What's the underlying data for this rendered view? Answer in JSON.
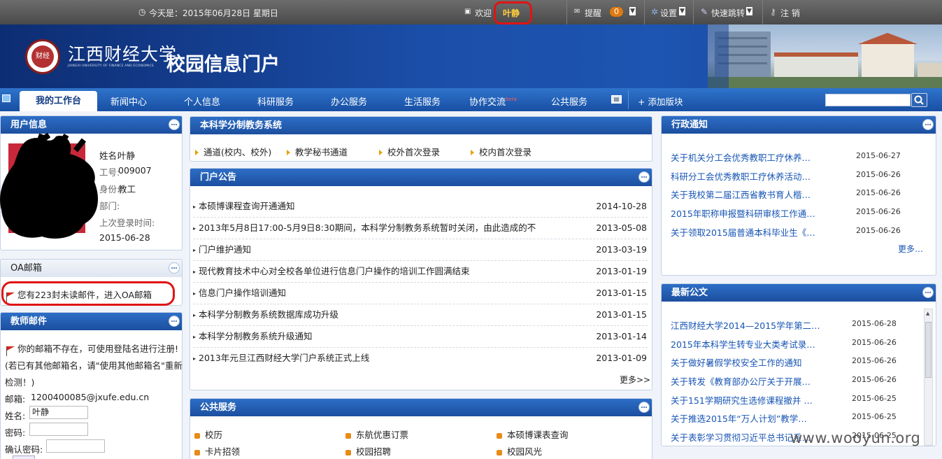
{
  "topbar": {
    "date": "今天是：2015年06月28日 星期日",
    "welcome": "欢迎",
    "username": "叶静",
    "remind": "提醒",
    "remind_count": "0",
    "settings": "设置",
    "quick_jump": "快速跳转",
    "logout": "注 销"
  },
  "header": {
    "uni_name": "江西财经大学",
    "uni_name_en": "JIANGXI UNIVERSITY OF FINANCE AND ECONOMICS",
    "logo_text": "财经",
    "portal_title": "校园信息门户"
  },
  "nav": {
    "items": [
      "我的工作台",
      "新闻中心",
      "个人信息",
      "科研服务",
      "办公服务",
      "生活服务",
      "协作交流",
      "公共服务"
    ],
    "new_badge": "beta",
    "add_block": "+ 添加版块"
  },
  "user_info": {
    "title": "用户信息",
    "name_label": "姓名:",
    "name": "叶静",
    "id_label": "工号:",
    "id": "009007",
    "role_label": "身份:",
    "role": "教工",
    "dept_label": "部门:",
    "last_login_label": "上次登录时间:",
    "last_login": "2015-06-28"
  },
  "oa_mail": {
    "title": "OA邮箱",
    "text": "您有223封未读邮件，进入OA邮箱"
  },
  "teacher_mail": {
    "title": "教师邮件",
    "line1": "你的邮箱不存在，可使用登陆名进行注册!",
    "line2": "(若已有其他邮箱名，请\"使用其他邮箱名\"重新",
    "line3": "检测！)",
    "email_label": "邮箱:",
    "email": "1200400085@jxufe.edu.cn",
    "name_label": "姓名:",
    "name_value": "叶静",
    "password_label": "密码:",
    "confirm_label": "确认密码:"
  },
  "academic": {
    "title": "本科学分制教务系统",
    "links": [
      "通道(校内、校外)",
      "教学秘书通道",
      "校外首次登录",
      "校内首次登录"
    ]
  },
  "announcements": {
    "title": "门户公告",
    "items": [
      {
        "title": "本硕博课程查询开通通知",
        "date": "2014-10-28"
      },
      {
        "title": "2013年5月8日17:00-5月9日8:30期间，本科学分制教务系统暂时关闭，由此造成的不",
        "date": "2013-05-08"
      },
      {
        "title": "门户维护通知",
        "date": "2013-03-19"
      },
      {
        "title": "现代教育技术中心对全校各单位进行信息门户操作的培训工作圆满结束",
        "date": "2013-01-19"
      },
      {
        "title": "信息门户操作培训通知",
        "date": "2013-01-15"
      },
      {
        "title": "本科学分制教务系统数据库成功升级",
        "date": "2013-01-15"
      },
      {
        "title": "本科学分制教务系统升级通知",
        "date": "2013-01-14"
      },
      {
        "title": "2013年元旦江西财经大学门户系统正式上线",
        "date": "2013-01-09"
      }
    ],
    "more": "更多>>"
  },
  "public_services": {
    "title": "公共服务",
    "items": [
      "校历",
      "东航优惠订票",
      "本硕博课表查询",
      "卡片招领",
      "校园招聘",
      "校园风光"
    ]
  },
  "admin_notices": {
    "title": "行政通知",
    "items": [
      {
        "title": "关于机关分工会优秀教职工疗休养…",
        "date": "2015-06-27"
      },
      {
        "title": "科研分工会优秀教职工疗休养活动…",
        "date": "2015-06-26"
      },
      {
        "title": "关于我校第二届江西省教书育人楷…",
        "date": "2015-06-26"
      },
      {
        "title": "2015年职称申报暨科研审核工作通…",
        "date": "2015-06-26"
      },
      {
        "title": "关于领取2015届普通本科毕业生《…",
        "date": "2015-06-26"
      }
    ],
    "more": "更多…"
  },
  "latest_docs": {
    "title": "最新公文",
    "items": [
      {
        "title": "江西财经大学2014—2015学年第二…",
        "date": "2015-06-28"
      },
      {
        "title": "2015年本科学生转专业大类考试录…",
        "date": "2015-06-26"
      },
      {
        "title": "关于做好暑假学校安全工作的通知",
        "date": "2015-06-26"
      },
      {
        "title": "关于转发《教育部办公厅关于开展…",
        "date": "2015-06-26"
      },
      {
        "title": "关于151学期研究生选修课程撤并 …",
        "date": "2015-06-25"
      },
      {
        "title": "关于推选2015年“万人计划”教学…",
        "date": "2015-06-25"
      },
      {
        "title": "关于表彰学习贯彻习近平总书记系…",
        "date": "2015-06-25"
      }
    ]
  },
  "watermark": "www.wooyun.org",
  "colors": {
    "nav_blue": "#1f5bb5",
    "link_blue": "#1755b4",
    "highlight_red": "#e01414",
    "username_yellow": "#ffcf3a"
  }
}
